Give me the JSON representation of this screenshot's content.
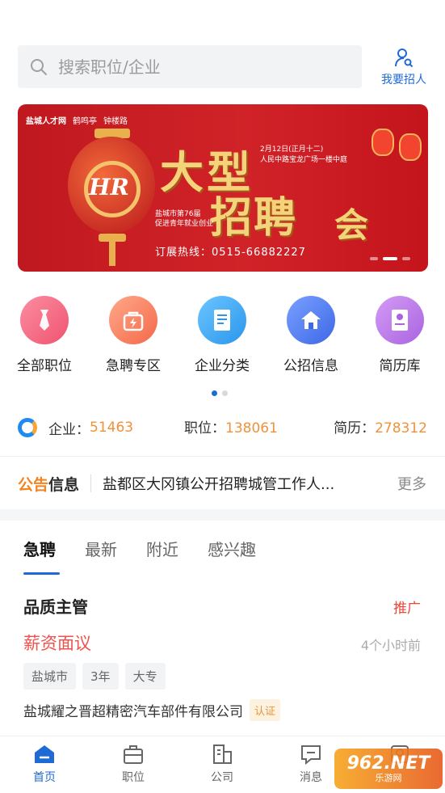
{
  "search": {
    "placeholder": "搜索职位/企业"
  },
  "recruit_button": {
    "label": "我要招人"
  },
  "banner": {
    "logos": [
      "盐城人才网",
      "鹤鸣亭",
      "钟楼路"
    ],
    "title_line1": "大型",
    "title_line2": "招聘",
    "title_line3": "会",
    "date": "2月12日(正月十二)",
    "venue": "人民中路宝龙广场一楼中庭",
    "sub_line1": "盐城市第76届",
    "sub_line2": "促进青年就业创业",
    "hotline": "订展热线：0515-66882227",
    "page_count": 3,
    "active_page": 2
  },
  "categories": [
    {
      "label": "全部职位",
      "icon": "tie-icon",
      "color": "#f26a84"
    },
    {
      "label": "急聘专区",
      "icon": "bag-lightning-icon",
      "color": "#f6845d"
    },
    {
      "label": "企业分类",
      "icon": "document-icon",
      "color": "#3aa8f2"
    },
    {
      "label": "公招信息",
      "icon": "home-icon",
      "color": "#4f7ef0"
    },
    {
      "label": "简历库",
      "icon": "resume-icon",
      "color": "#b77ae6"
    }
  ],
  "stats": {
    "company_label": "企业：",
    "company_value": "51463",
    "job_label": "职位：",
    "job_value": "138061",
    "resume_label": "简历：",
    "resume_value": "278312"
  },
  "notice": {
    "tag_part1": "公告",
    "tag_part2": "信息",
    "text": "盐都区大冈镇公开招聘城管工作人...",
    "more": "更多"
  },
  "tabs": [
    {
      "label": "急聘",
      "active": true
    },
    {
      "label": "最新",
      "active": false
    },
    {
      "label": "附近",
      "active": false
    },
    {
      "label": "感兴趣",
      "active": false
    }
  ],
  "job": {
    "title": "品质主管",
    "badge": "推广",
    "salary": "薪资面议",
    "time": "4个小时前",
    "tags": [
      "盐城市",
      "3年",
      "大专"
    ],
    "company": "盐城耀之晋超精密汽车部件有限公司",
    "cert": "认证"
  },
  "nav": [
    {
      "label": "首页",
      "icon": "home-tab-icon",
      "active": true
    },
    {
      "label": "职位",
      "icon": "briefcase-icon",
      "active": false
    },
    {
      "label": "公司",
      "icon": "building-icon",
      "active": false
    },
    {
      "label": "消息",
      "icon": "message-icon",
      "active": false
    },
    {
      "label": "",
      "icon": "profile-icon",
      "active": false
    }
  ],
  "watermark": {
    "line1": "962.NET",
    "line2": "乐游网"
  },
  "colors": {
    "accent": "#1f6bd6",
    "orange": "#f29138",
    "red": "#f0514c"
  }
}
